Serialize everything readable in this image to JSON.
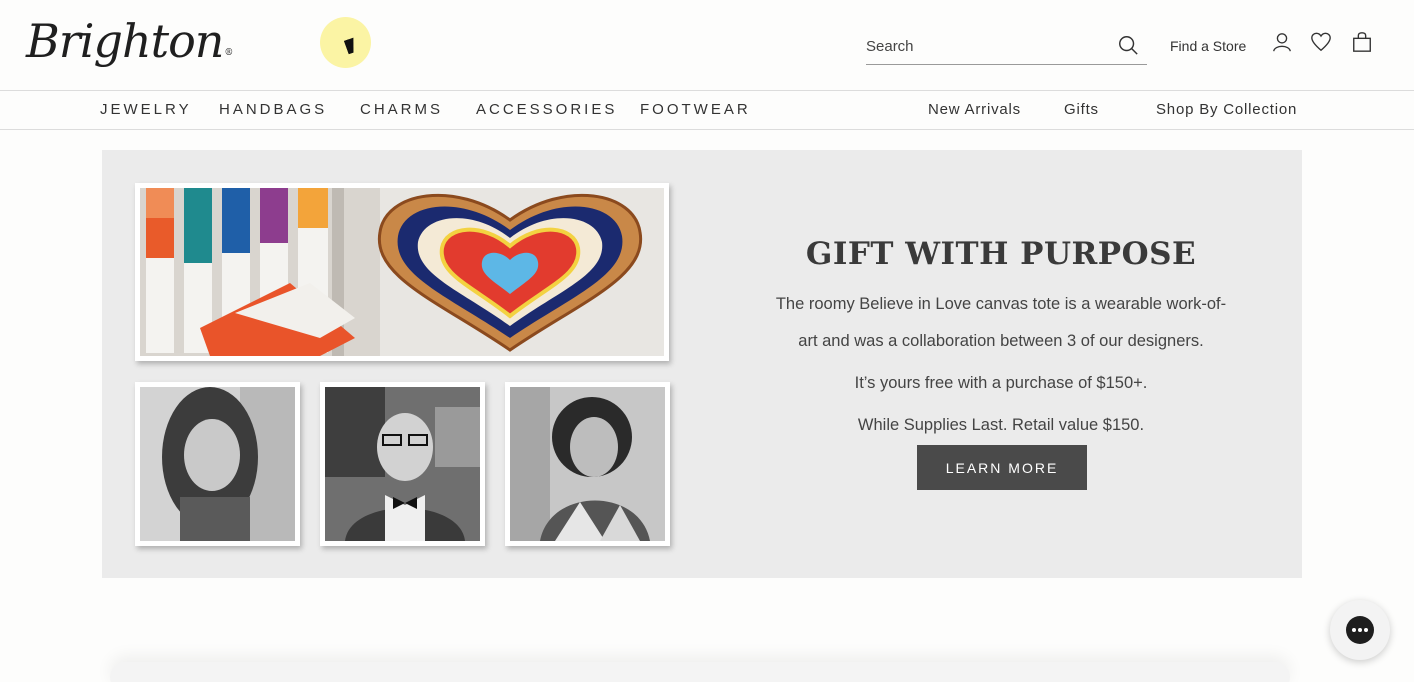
{
  "header": {
    "logo_text": "Brighton",
    "logo_mark": "®",
    "search_placeholder": "Search",
    "find_store": "Find a Store",
    "icons": [
      "search-icon",
      "account-icon",
      "heart-icon",
      "bag-icon"
    ]
  },
  "nav": {
    "categories": [
      "JEWELRY",
      "HANDBAGS",
      "CHARMS",
      "ACCESSORIES",
      "FOOTWEAR"
    ],
    "right": [
      "New Arrivals",
      "Gifts",
      "Shop By Collection"
    ]
  },
  "banner": {
    "headline": "GIFT WITH PURPOSE",
    "paragraphs": [
      "The roomy Believe in Love canvas tote is a wearable work-of-art and was a collaboration between 3 of our designers.",
      "It’s yours free with a purchase of $150+.",
      "While Supplies Last. Retail value $150."
    ],
    "cta": "LEARN MORE"
  },
  "colors": {
    "banner_bg": "#ebebeb",
    "cta_bg": "#4a4a4a",
    "text": "#333333"
  }
}
